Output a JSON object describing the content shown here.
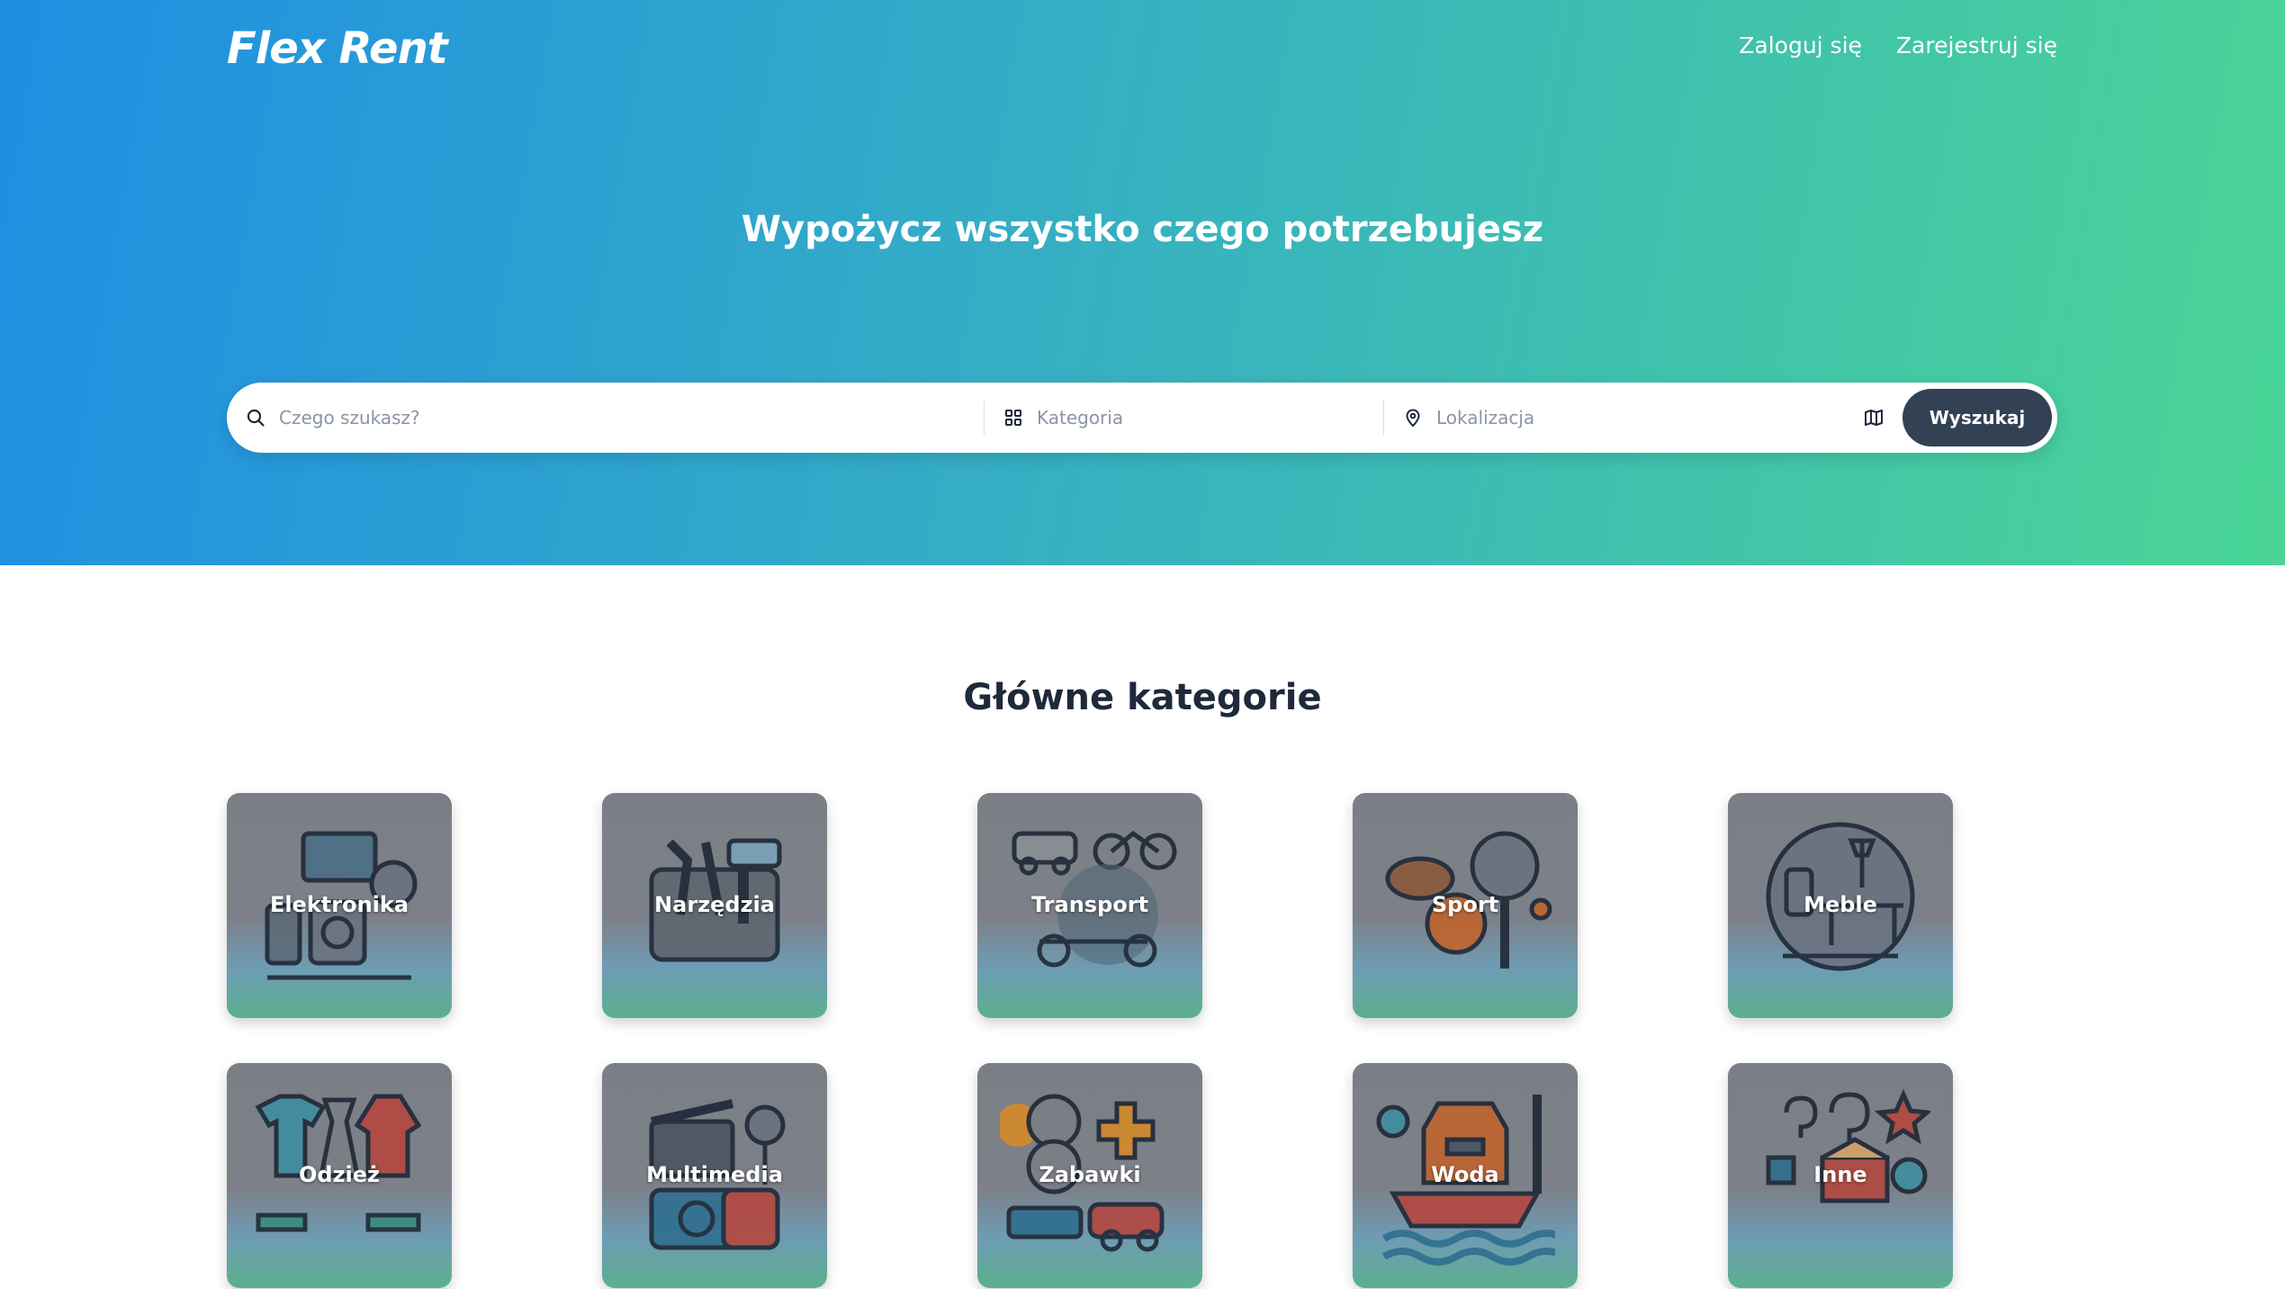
{
  "header": {
    "logo": "Flex Rent",
    "nav": {
      "login": "Zaloguj się",
      "register": "Zarejestruj się"
    }
  },
  "hero": {
    "title": "Wypożycz wszystko czego potrzebujesz"
  },
  "search": {
    "query_placeholder": "Czego szukasz?",
    "category_placeholder": "Kategoria",
    "location_placeholder": "Lokalizacja",
    "button_label": "Wyszukaj",
    "icons": [
      "search-icon",
      "grid-icon",
      "location-pin-icon",
      "map-icon"
    ]
  },
  "categories": {
    "title": "Główne kategorie",
    "items": [
      {
        "label": "Elektronika",
        "icon": "electronics-icon"
      },
      {
        "label": "Narzędzia",
        "icon": "tools-icon"
      },
      {
        "label": "Transport",
        "icon": "transport-icon"
      },
      {
        "label": "Sport",
        "icon": "sport-icon"
      },
      {
        "label": "Meble",
        "icon": "furniture-icon"
      },
      {
        "label": "Odzież",
        "icon": "clothing-icon"
      },
      {
        "label": "Multimedia",
        "icon": "multimedia-icon"
      },
      {
        "label": "Zabawki",
        "icon": "toys-icon"
      },
      {
        "label": "Woda",
        "icon": "water-icon"
      },
      {
        "label": "Inne",
        "icon": "other-icon"
      }
    ]
  },
  "colors": {
    "gradient_start": "#1f8ee3",
    "gradient_end": "#4ad596",
    "button": "#334155"
  }
}
